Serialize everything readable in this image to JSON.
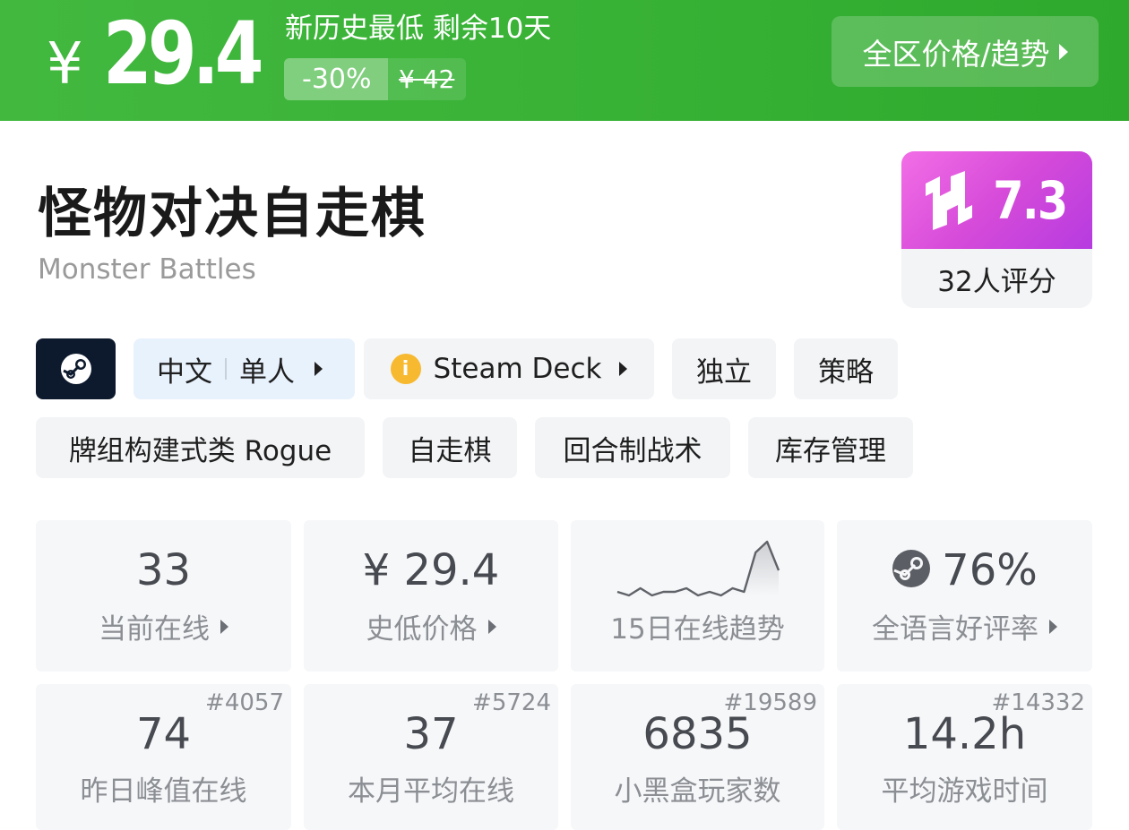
{
  "banner": {
    "currency_symbol": "¥",
    "current_price": "29.4",
    "note": "新历史最低 剩余10天",
    "discount": "-30%",
    "original_price": "¥ 42",
    "region_button": "全区价格/趋势",
    "bg_color": "#37b134"
  },
  "game": {
    "title_cn": "怪物对决自走棋",
    "title_en": "Monster Battles",
    "score": "7.3",
    "rating_count": "32人评分"
  },
  "tags": {
    "platform_icon": "steam-icon",
    "language": "中文",
    "mode": "单人",
    "steam_deck": "Steam Deck",
    "items": [
      "独立",
      "策略",
      "牌组构建式类 Rogue",
      "自走棋",
      "回合制战术",
      "库存管理"
    ]
  },
  "stats": {
    "online_now": {
      "value": "33",
      "label": "当前在线"
    },
    "lowest_price": {
      "value": "¥ 29.4",
      "label": "史低价格"
    },
    "trend": {
      "label": "15日在线趋势",
      "values": [
        4,
        3,
        5,
        3,
        4,
        4,
        5,
        3,
        4,
        3,
        5,
        4,
        15,
        18,
        10
      ]
    },
    "review": {
      "value": "76%",
      "label": "全语言好评率"
    },
    "peak_yesterday": {
      "value": "74",
      "label": "昨日峰值在线",
      "rank": "#4057"
    },
    "monthly_avg": {
      "value": "37",
      "label": "本月平均在线",
      "rank": "#5724"
    },
    "players": {
      "value": "6835",
      "label": "小黑盒玩家数",
      "rank": "#19589"
    },
    "playtime": {
      "value": "14.2h",
      "label": "平均游戏时间",
      "rank": "#14332"
    }
  }
}
